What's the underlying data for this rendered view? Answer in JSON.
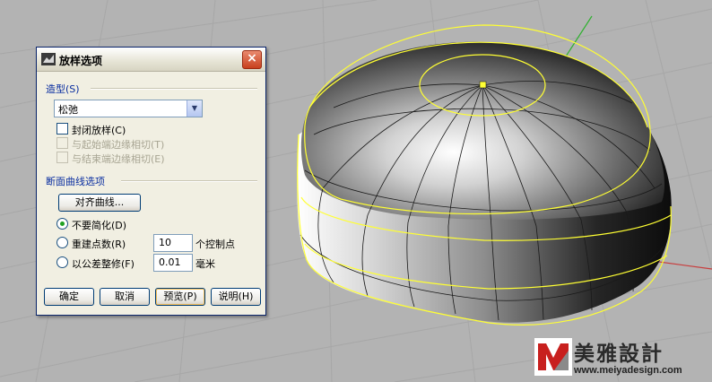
{
  "dialog": {
    "title": "放样选项",
    "close_glyph": "×",
    "style_section": "造型(S)",
    "style_value": "松弛",
    "closed_loft": "封闭放样(C)",
    "match_start": "与起始端边缘相切(T)",
    "match_end": "与结束端边缘相切(E)",
    "cross_section": "断面曲线选项",
    "align_button": "对齐曲线...",
    "options": {
      "no_simplify": "不要简化(D)",
      "rebuild": "重建点数(R)",
      "refit": "以公差整修(F)"
    },
    "rebuild_value": "10",
    "rebuild_unit": "个控制点",
    "refit_value": "0.01",
    "refit_unit": "毫米",
    "buttons": {
      "ok": "确定",
      "cancel": "取消",
      "preview": "预览(P)",
      "help": "说明(H)"
    }
  },
  "logo": {
    "name": "美雅設計",
    "url": "www.meiyadesign.com"
  },
  "colors": {
    "viewport_bg": "#b3b3b3",
    "grid": "#a5a5a5",
    "highlight_curve": "#ffff33",
    "dialog_bg": "#f1efe2",
    "section_label": "#0a2ea0"
  },
  "icons": [
    "rhino-app-icon",
    "close-icon",
    "chevron-down-icon",
    "checkbox-icon",
    "radio-icon",
    "world-axis-icon",
    "logo-icon"
  ]
}
